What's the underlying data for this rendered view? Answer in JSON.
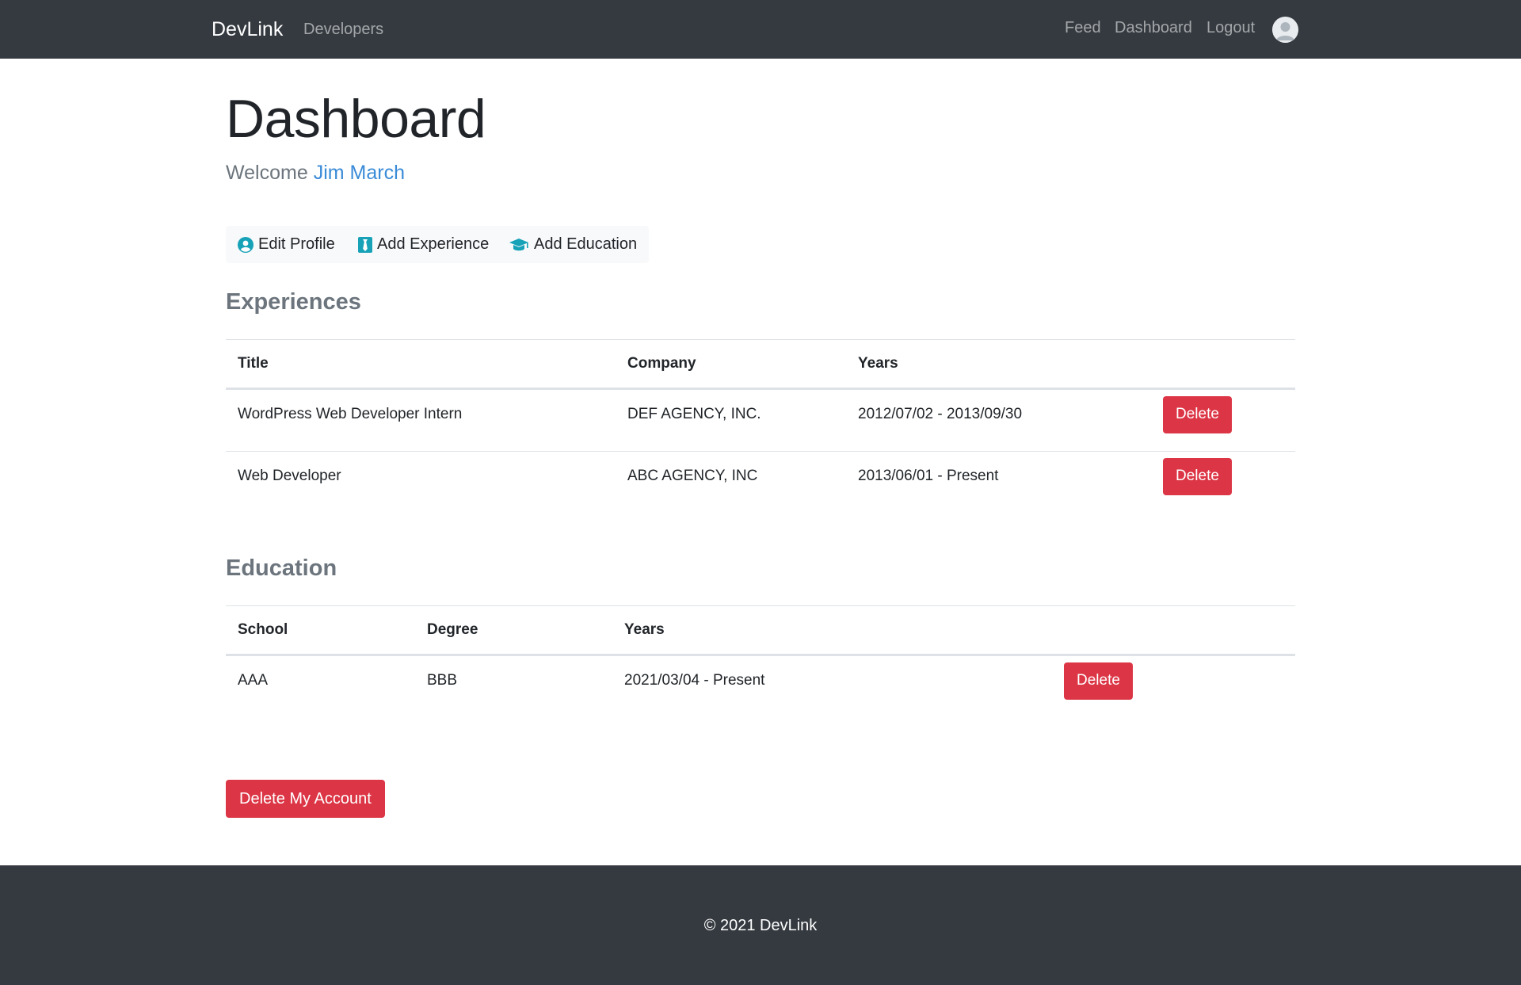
{
  "navbar": {
    "brand": "DevLink",
    "left_links": [
      "Developers"
    ],
    "right_links": [
      "Feed",
      "Dashboard",
      "Logout"
    ],
    "avatar_icon": "user-avatar-icon"
  },
  "main": {
    "title": "Dashboard",
    "welcome_prefix": "Welcome",
    "user_name": "Jim March",
    "actions": {
      "edit_profile": "Edit Profile",
      "add_experience": "Add Experience",
      "add_education": "Add Education"
    },
    "experiences": {
      "heading": "Experiences",
      "columns": [
        "Title",
        "Company",
        "Years"
      ],
      "rows": [
        {
          "title": "WordPress Web Developer Intern",
          "company": "DEF AGENCY, INC.",
          "years": "2012/07/02 - 2013/09/30",
          "action": "Delete"
        },
        {
          "title": "Web Developer",
          "company": "ABC AGENCY, INC",
          "years": "2013/06/01 - Present",
          "action": "Delete"
        }
      ]
    },
    "education": {
      "heading": "Education",
      "columns": [
        "School",
        "Degree",
        "Years"
      ],
      "rows": [
        {
          "school": "AAA",
          "degree": "BBB",
          "years": "2021/03/04 - Present",
          "action": "Delete"
        }
      ]
    },
    "delete_account_label": "Delete My Account"
  },
  "footer": {
    "text": "© 2021 DevLink"
  },
  "colors": {
    "navbar_bg": "#343a40",
    "danger": "#dc3545",
    "link_blue": "#3a8bd8",
    "icon_teal": "#17a2b8",
    "muted": "#6c757d"
  }
}
